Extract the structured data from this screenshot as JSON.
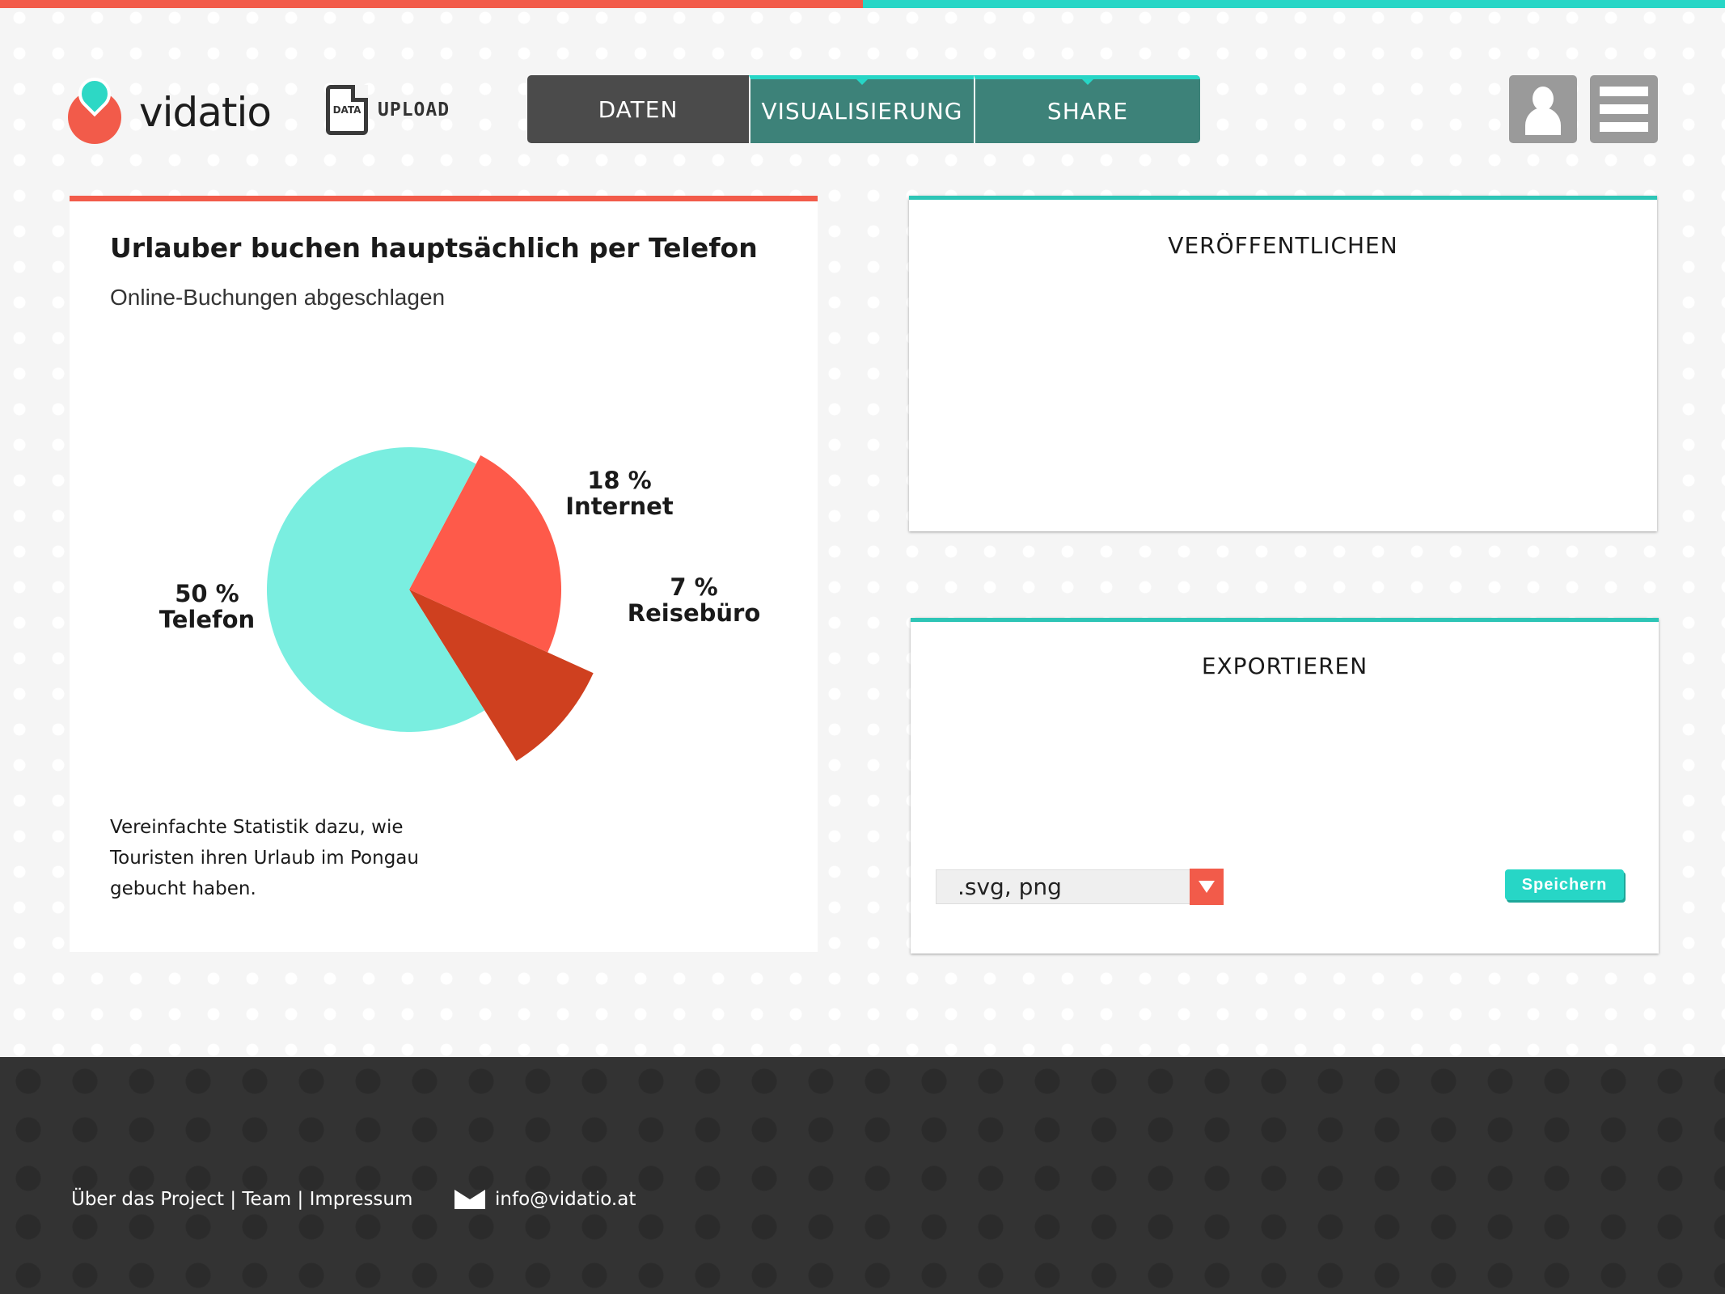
{
  "app": {
    "brand": "vidatio"
  },
  "header": {
    "upload_icon_text": "DATA",
    "upload_label": "UPLOAD",
    "tabs": [
      {
        "label": "DATEN"
      },
      {
        "label": "VISUALISIERUNG"
      },
      {
        "label": "SHARE"
      }
    ]
  },
  "chart_card": {
    "description": "Vereinfachte Statistik dazu, wie Touristen ihren Urlaub im Pongau gebucht haben."
  },
  "chart_data": {
    "type": "pie",
    "title": "Urlauber buchen hauptsächlich per Telefon",
    "subtitle": "Online-Buchungen abgeschlagen",
    "slices": [
      {
        "label": "Telefon",
        "value": 50,
        "value_label": "50 %",
        "color": "#7aeee0",
        "exploded": false
      },
      {
        "label": "Internet",
        "value": 18,
        "value_label": "18 %",
        "color": "#fe5a4a",
        "exploded": true
      },
      {
        "label": "Reisebüro",
        "value": 7,
        "value_label": "7 %",
        "color": "#cf401f",
        "exploded": true
      }
    ]
  },
  "publish": {
    "title": "VERÖFFENTLICHEN"
  },
  "export": {
    "title": "EXPORTIEREN",
    "format_value": ".svg, png",
    "save_label": "Speichern"
  },
  "footer": {
    "links": "Über das Project | Team | Impressum",
    "email": "info@vidatio.at"
  },
  "colors": {
    "accent_red": "#f25b4a",
    "accent_teal": "#27d6c6",
    "tab_dark": "#4b4b4b",
    "tab_teal": "#3d8279",
    "footer_bg": "#333333"
  }
}
